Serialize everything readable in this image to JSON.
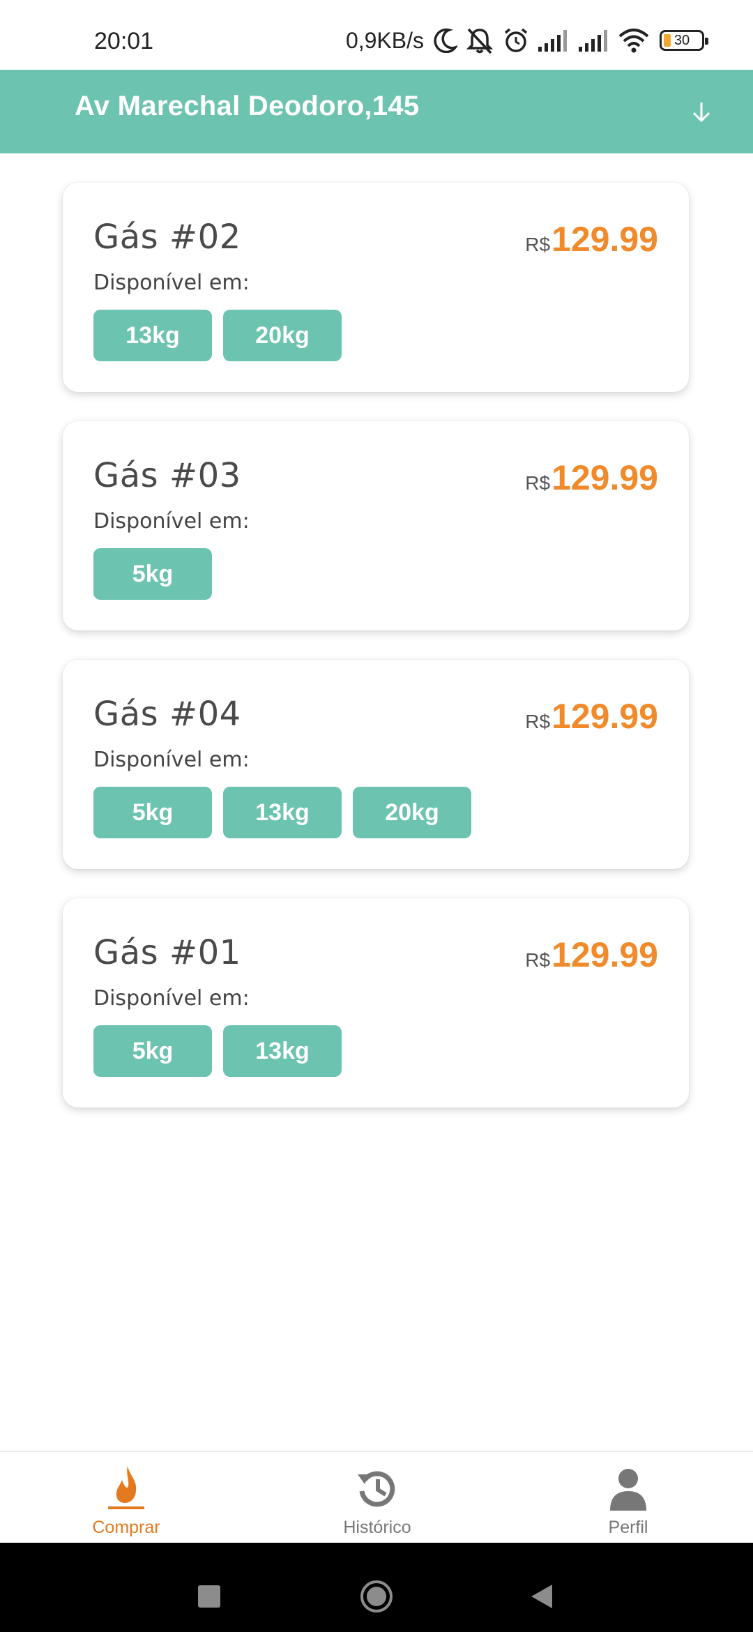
{
  "status_bar": {
    "time": "20:01",
    "net_speed": "0,9KB/s",
    "battery": "30"
  },
  "header": {
    "address": "Av Marechal Deodoro,145",
    "dropdown_icon": "arrow-down-icon"
  },
  "products": [
    {
      "name": "Gás #02",
      "currency": "R$",
      "price": "129.99",
      "available_label": "Disponível em:",
      "sizes": [
        "13kg",
        "20kg"
      ]
    },
    {
      "name": "Gás #03",
      "currency": "R$",
      "price": "129.99",
      "available_label": "Disponível em:",
      "sizes": [
        "5kg"
      ]
    },
    {
      "name": "Gás #04",
      "currency": "R$",
      "price": "129.99",
      "available_label": "Disponível em:",
      "sizes": [
        "5kg",
        "13kg",
        "20kg"
      ]
    },
    {
      "name": "Gás #01",
      "currency": "R$",
      "price": "129.99",
      "available_label": "Disponível em:",
      "sizes": [
        "5kg",
        "13kg"
      ]
    }
  ],
  "bottom_nav": {
    "items": [
      {
        "label": "Comprar",
        "icon": "flame-icon",
        "active": true
      },
      {
        "label": "Histórico",
        "icon": "history-icon",
        "active": false
      },
      {
        "label": "Perfil",
        "icon": "person-icon",
        "active": false
      }
    ]
  },
  "colors": {
    "accent": "#6cc3b0",
    "price": "#f08a2a",
    "active_nav": "#e47a20"
  }
}
